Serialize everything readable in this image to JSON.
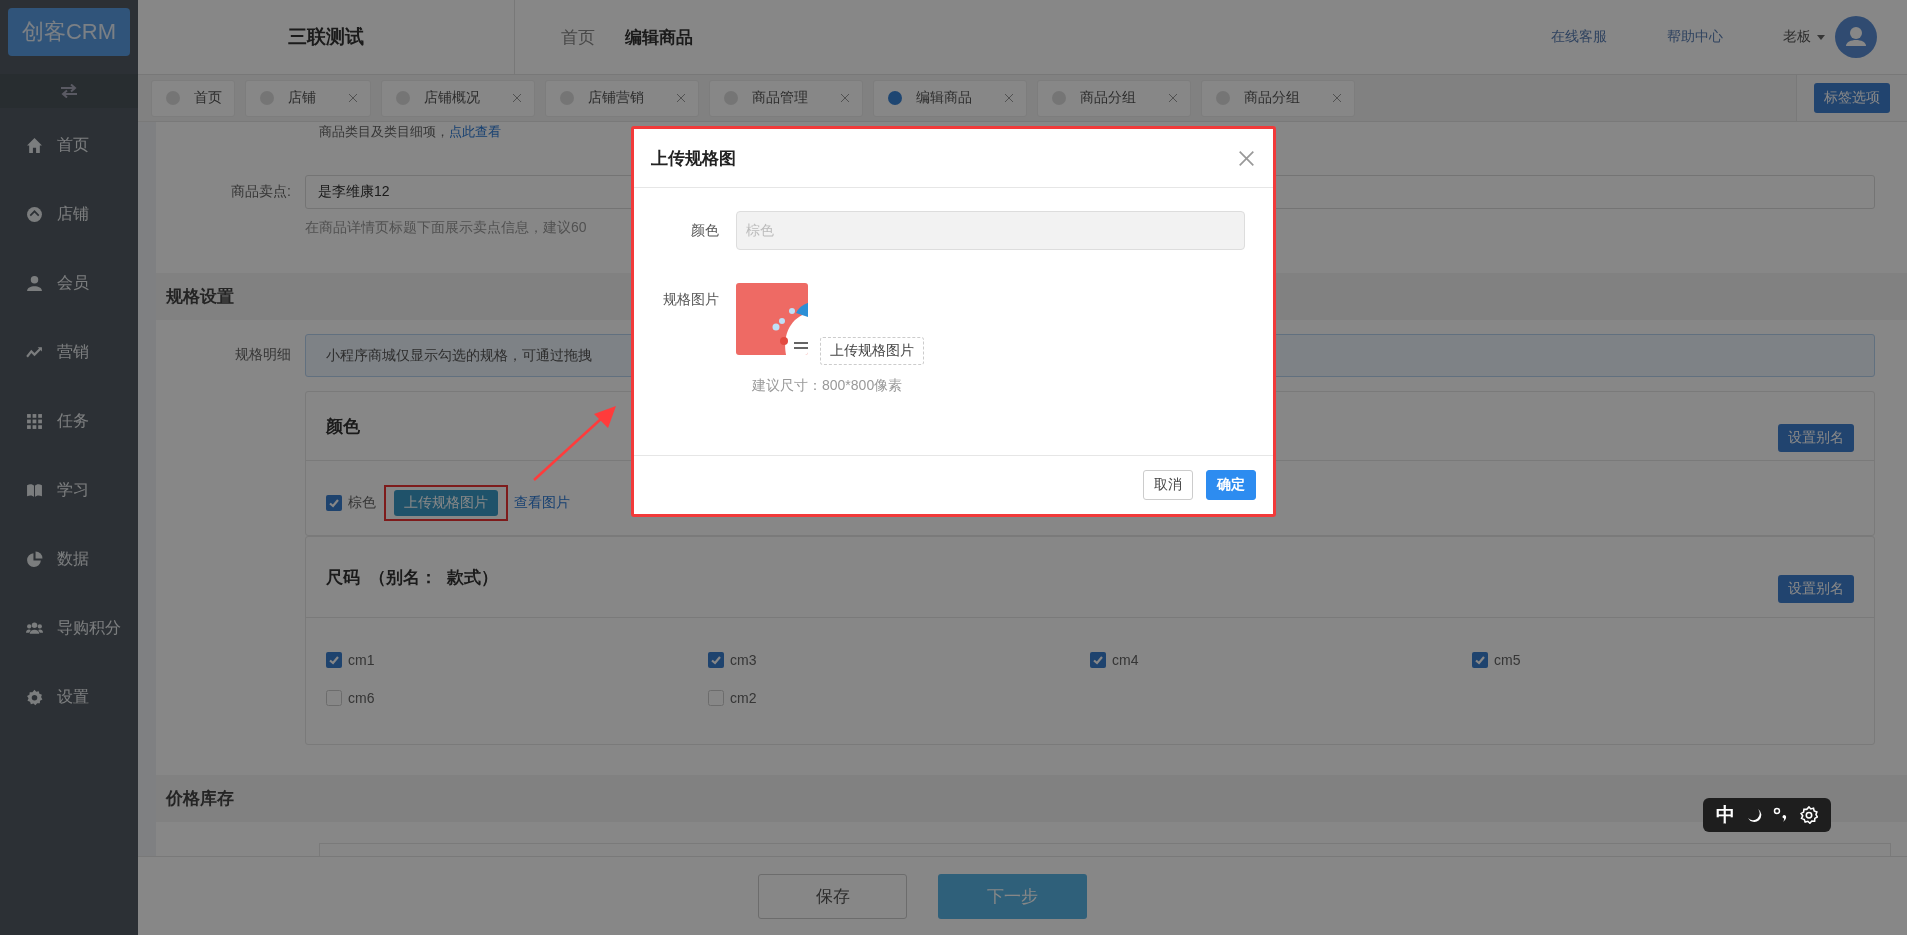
{
  "sidebar": {
    "logo": "创客CRM",
    "items": [
      {
        "label": "首页"
      },
      {
        "label": "店铺"
      },
      {
        "label": "会员"
      },
      {
        "label": "营销"
      },
      {
        "label": "任务"
      },
      {
        "label": "学习"
      },
      {
        "label": "数据"
      },
      {
        "label": "导购积分"
      },
      {
        "label": "设置"
      }
    ]
  },
  "header": {
    "title": "三联测试",
    "breadcrumb": [
      {
        "label": "首页",
        "selected": false
      },
      {
        "label": "编辑商品",
        "selected": true
      }
    ],
    "links": [
      "在线客服",
      "帮助中心"
    ],
    "user": "老板"
  },
  "tabs": [
    {
      "label": "首页",
      "selected": false,
      "closable": false
    },
    {
      "label": "店铺",
      "selected": false,
      "closable": true
    },
    {
      "label": "店铺概况",
      "selected": false,
      "closable": true
    },
    {
      "label": "店铺营销",
      "selected": false,
      "closable": true
    },
    {
      "label": "商品管理",
      "selected": false,
      "closable": true
    },
    {
      "label": "编辑商品",
      "selected": true,
      "closable": true
    },
    {
      "label": "商品分组",
      "selected": false,
      "closable": true
    },
    {
      "label": "商品分组",
      "selected": false,
      "closable": true
    }
  ],
  "tab_options_button": "标签选项",
  "form": {
    "top_note": "商品类目及类目细项，",
    "top_link": "点此查看",
    "selling_point": {
      "label": "商品卖点:",
      "value": "是李维康12",
      "hint": "在商品详情页标题下面展示卖点信息，建议60"
    },
    "spec_section": {
      "title": "规格设置",
      "detail_label": "规格明细",
      "info": "小程序商城仅显示勾选的规格，可通过拖拽",
      "color_group": {
        "title": "颜色",
        "alias_button": "设置别名",
        "options": [
          {
            "label": "棕色",
            "checked": true,
            "upload_button": "上传规格图片",
            "view_link": "查看图片"
          }
        ]
      },
      "size_group": {
        "title": "尺码",
        "alias": "（别名：  款式）",
        "alias_button": "设置别名",
        "options": [
          {
            "label": "cm1",
            "checked": true
          },
          {
            "label": "cm3",
            "checked": true
          },
          {
            "label": "cm4",
            "checked": true
          },
          {
            "label": "cm5",
            "checked": true
          },
          {
            "label": "cm6",
            "checked": false
          },
          {
            "label": "cm2",
            "checked": false
          }
        ]
      }
    },
    "price_section": {
      "title": "价格库存"
    }
  },
  "footer": {
    "buttons": [
      {
        "label": "保存",
        "kind": "default"
      },
      {
        "label": "下一步",
        "kind": "primary"
      }
    ]
  },
  "modal": {
    "title": "上传规格图",
    "color_label": "颜色",
    "color_value": "棕色",
    "color_disabled": true,
    "image_label": "规格图片",
    "upload_button": "上传规格图片",
    "hint": "建议尺寸：800*800像素",
    "buttons": [
      {
        "label": "取消",
        "kind": "default"
      },
      {
        "label": "确定",
        "kind": "primary"
      }
    ]
  },
  "ime": {
    "mode": "中"
  }
}
